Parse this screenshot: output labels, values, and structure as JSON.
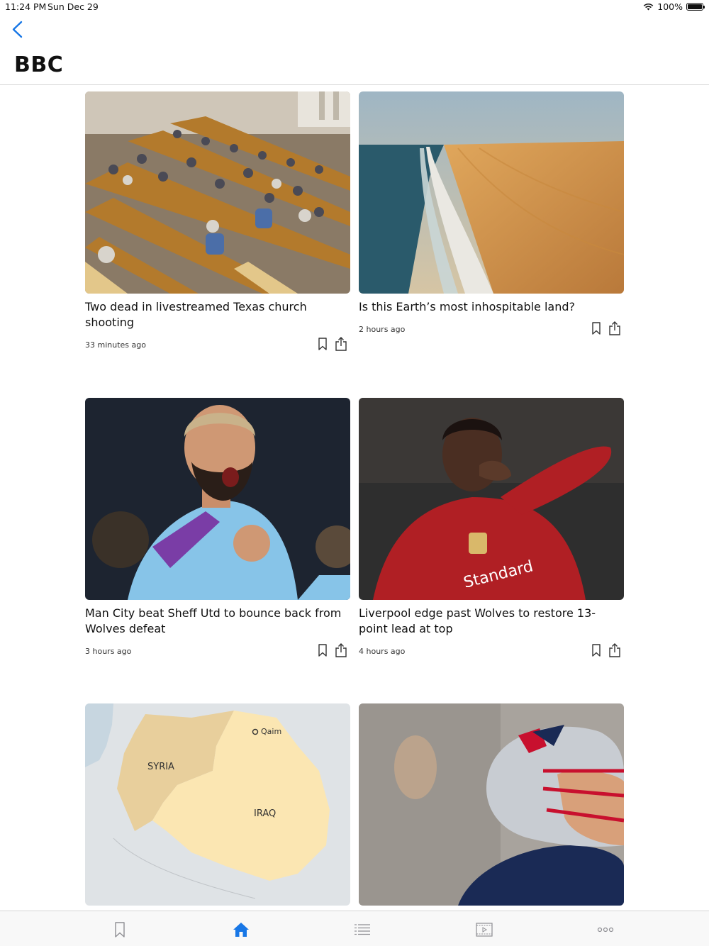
{
  "status_bar": {
    "time": "11:24 PM",
    "date": "Sun Dec 29",
    "battery": "100%"
  },
  "header": {
    "title": "BBC",
    "back_icon": "chevron-left-icon"
  },
  "articles": [
    {
      "title": "Two dead in livestreamed Texas church shooting",
      "time": "33 minutes ago",
      "image": "church-congregation-photo"
    },
    {
      "title": "Is this Earth’s most inhospitable land?",
      "time": "2 hours ago",
      "image": "desert-coastline-photo"
    },
    {
      "title": "Man City beat Sheff Utd to bounce back from Wolves defeat",
      "time": "3 hours ago",
      "image": "footballer-celebrating-photo"
    },
    {
      "title": "Liverpool edge past Wolves to restore 13-point lead at top",
      "time": "4 hours ago",
      "image": "footballer-red-kit-photo"
    },
    {
      "title": "",
      "time": "",
      "image": "map-syria-iraq",
      "map_labels": [
        "SYRIA",
        "IRAQ",
        "Qaim"
      ]
    },
    {
      "title": "",
      "time": "",
      "image": "american-football-player-photo"
    }
  ],
  "tabs": [
    {
      "name": "bookmarks",
      "icon": "bookmark-icon",
      "active": false
    },
    {
      "name": "home",
      "icon": "home-icon",
      "active": true
    },
    {
      "name": "list",
      "icon": "list-icon",
      "active": false
    },
    {
      "name": "video",
      "icon": "video-icon",
      "active": false
    },
    {
      "name": "more",
      "icon": "more-icon",
      "active": false
    }
  ],
  "colors": {
    "accent": "#1877e6",
    "tab_inactive": "#8e8e93",
    "divider": "#d9d9d9"
  }
}
